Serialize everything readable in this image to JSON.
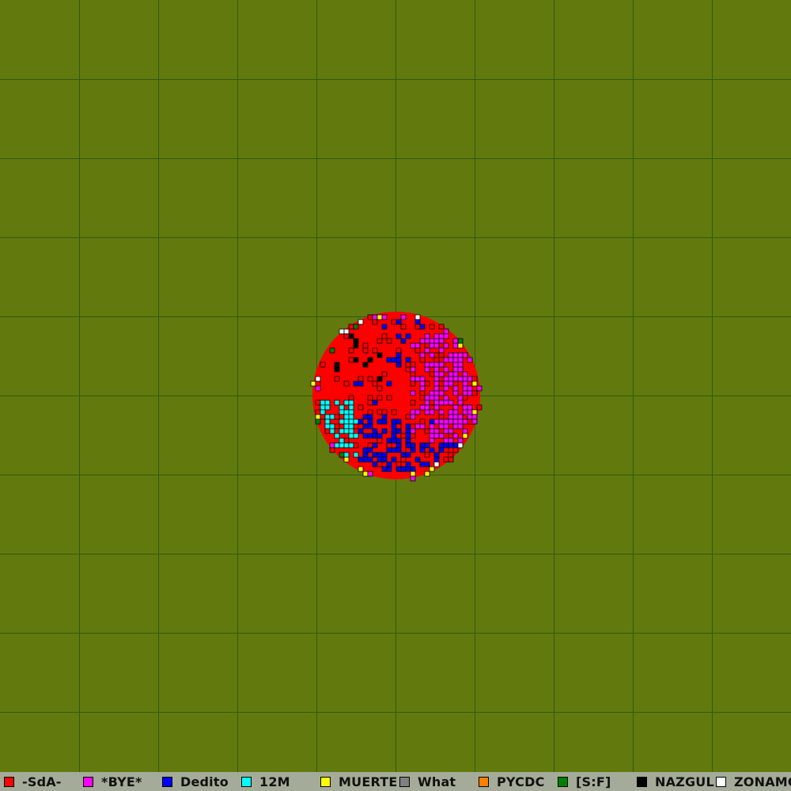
{
  "map": {
    "background_color": "#627a0d",
    "grid_color": "#2f5a12",
    "grid": {
      "columns": 10,
      "rows": 10
    },
    "territory_shape": "circle",
    "cell_border_color": "#000000"
  },
  "legend": {
    "items": [
      {
        "label": "-SdA-",
        "color": "#ff0000"
      },
      {
        "label": "*BYE*",
        "color": "#ff00ff"
      },
      {
        "label": "Dedito",
        "color": "#0000ff"
      },
      {
        "label": "12M",
        "color": "#00ffff"
      },
      {
        "label": "MUERTE",
        "color": "#ffff00"
      },
      {
        "label": "What",
        "color": "#808080"
      },
      {
        "label": "PYCDC",
        "color": "#ff8000"
      },
      {
        "label": "[S:F]",
        "color": "#008000"
      },
      {
        "label": "NAZGUL",
        "color": "#000000"
      },
      {
        "label": "ZONAMC",
        "color": "#ffffff"
      }
    ]
  }
}
